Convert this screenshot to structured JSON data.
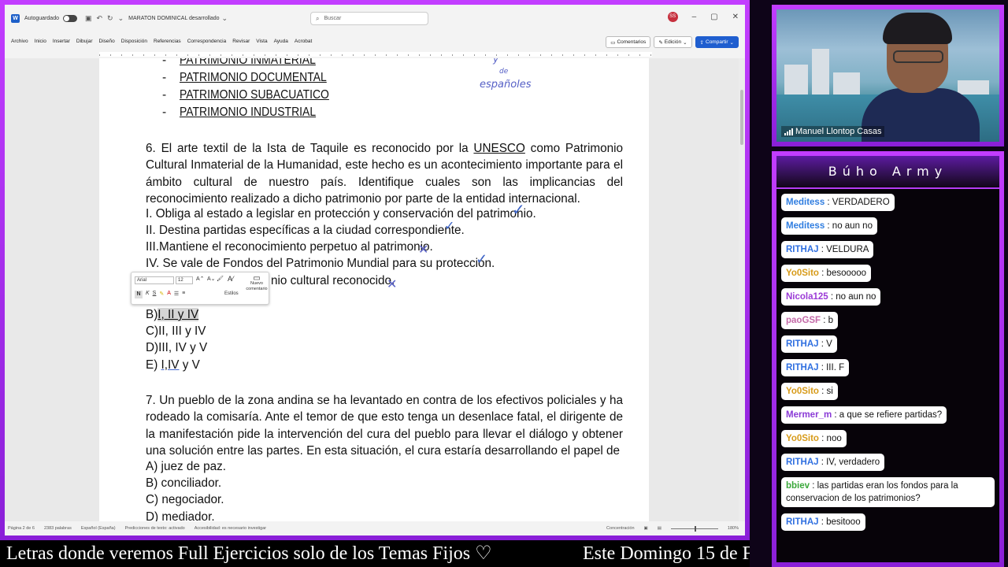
{
  "word": {
    "autosave_label": "Autoguardado",
    "doc_title": "MARATON DOMINICAL desarrollado",
    "search_placeholder": "Buscar",
    "user_initials": "SS",
    "menu": [
      "Archivo",
      "Inicio",
      "Insertar",
      "Dibujar",
      "Diseño",
      "Disposición",
      "Referencias",
      "Correspondencia",
      "Revisar",
      "Vista",
      "Ayuda",
      "Acrobat"
    ],
    "comments_label": "Comentarios",
    "editing_label": "Edición",
    "share_label": "Compartir",
    "statusbar": {
      "page": "Página 2 de 6",
      "words": "2383 palabras",
      "language": "Español (España)",
      "predictions": "Predicciones de texto: activado",
      "accessibility": "Accesibilidad: es necesario investigar",
      "focus": "Concentración",
      "zoom": "180%"
    },
    "mini_toolbar": {
      "font": "Arial",
      "size": "12",
      "edit_label": "Estilos",
      "comment_label": "Nuevo comentario"
    }
  },
  "document": {
    "patrimonios": [
      "PATRIMONIO INMATERIAL",
      "PATRIMONIO DOCUMENTAL",
      "PATRIMONIO SUBACUATICO",
      "PATRIMONIO INDUSTRIAL"
    ],
    "handwriting": [
      "y",
      "de",
      "españoles"
    ],
    "q6": {
      "number": "6.",
      "text_a": "El arte textil de la Ista de Taquile es reconocido por la ",
      "unesco": "UNESCO",
      "text_b": " como Patrimonio Cultural Inmaterial de la Humanidad, este hecho es un acontecimiento importante para el ámbito cultural de nuestro país. Identifique cuales son las implicancias del reconocimiento realizado a dicho patrimonio por parte de la entidad internacional.",
      "statements": [
        "I.  Obliga al estado a legislar en protección y conservación del patrimonio.",
        "II. Destina partidas específicas a la ciudad correspondiente.",
        "III.Mantiene el reconocimiento perpetuo al patrimonio.",
        "IV.  Se vale de Fondos del Patrimonio Mundial para su protección."
      ],
      "statement_v_tail": "nio cultural reconocido.",
      "options": [
        {
          "letter": "B)",
          "text": "I, II y IV"
        },
        {
          "letter": "C)",
          "text": "II, III y IV"
        },
        {
          "letter": "D)",
          "text": "III, IV y V"
        },
        {
          "letter": "E)",
          "text_u": "I,IV",
          "text_rest": " y V"
        }
      ]
    },
    "q7": {
      "number": "7.",
      "text": "Un pueblo de la zona andina se ha levantado en contra de los efectivos policiales y ha rodeado la comisaría. Ante el temor de que esto tenga un desenlace fatal, el dirigente de la manifestación pide la intervención del cura del pueblo para llevar el diálogo y obtener una solución entre las partes. En esta situación, el cura estaría desarrollando el papel de",
      "options": [
        "A) juez de paz.",
        "B) conciliador.",
        "C) negociador.",
        "D) mediador."
      ]
    }
  },
  "video": {
    "participant_name": "Manuel Llontop Casas"
  },
  "chat": {
    "title": "Búho Army",
    "messages": [
      {
        "user": "Meditess",
        "color": "#2f7de0",
        "text": " : VERDADERO"
      },
      {
        "user": "Meditess",
        "color": "#2f7de0",
        "text": " : no aun no"
      },
      {
        "user": "RITHAJ",
        "color": "#2f6fe0",
        "text": " : VELDURA"
      },
      {
        "user": "Yo0Sito",
        "color": "#d79b1a",
        "text": " : besooooo"
      },
      {
        "user": "Nicola125",
        "color": "#9b3ad6",
        "text": " : no aun no"
      },
      {
        "user": "paoGSF",
        "color": "#c46aa8",
        "text": " : b"
      },
      {
        "user": "RITHAJ",
        "color": "#2f6fe0",
        "text": " : V"
      },
      {
        "user": "RITHAJ",
        "color": "#2f6fe0",
        "text": " : III. F"
      },
      {
        "user": "Yo0Sito",
        "color": "#d79b1a",
        "text": " : si"
      },
      {
        "user": "Mermer_m",
        "color": "#8a3ad6",
        "text": " : a que se refiere partidas?"
      },
      {
        "user": "Yo0Sito",
        "color": "#d79b1a",
        "text": " : noo"
      },
      {
        "user": "RITHAJ",
        "color": "#2f6fe0",
        "text": " : IV, verdadero"
      },
      {
        "user": "bbiev",
        "color": "#3aa83a",
        "text": " : las partidas eran los fondos para la conservacion de los patrimonios?"
      },
      {
        "user": "RITHAJ",
        "color": "#2f6fe0",
        "text": " : besitooo"
      }
    ]
  },
  "ticker": {
    "left": "Letras donde veremos Full Ejercicios solo de los Temas Fijos ♡",
    "right": "Este Domingo 15 de F"
  }
}
